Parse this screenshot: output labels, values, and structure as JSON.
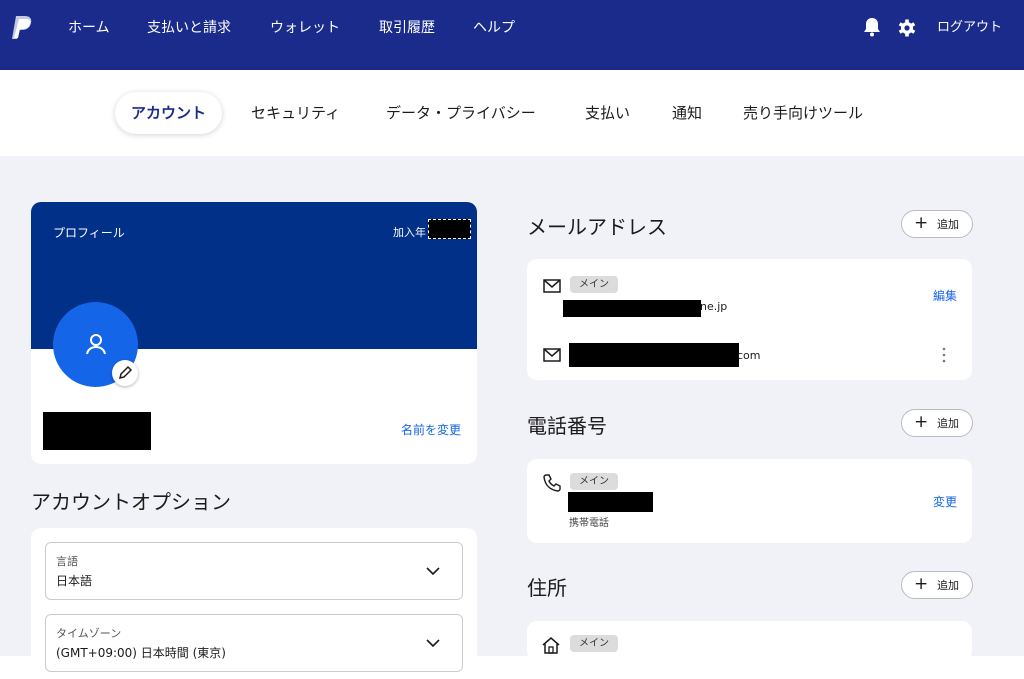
{
  "header": {
    "nav": [
      "ホーム",
      "支払いと請求",
      "ウォレット",
      "取引履歴",
      "ヘルプ"
    ],
    "logout": "ログアウト",
    "icons": [
      "bell-icon",
      "gear-icon"
    ],
    "bg_color": "#1a2b8c"
  },
  "tabs": [
    "アカウント",
    "セキュリティ",
    "データ・プライバシー",
    "支払い",
    "通知",
    "売り手向けツール"
  ],
  "profile": {
    "title": "プロフィール",
    "joined_label": "加入年",
    "change_name": "名前を変更",
    "banner_color": "#003087"
  },
  "account_options": {
    "title": "アカウントオプション",
    "language": {
      "label": "言語",
      "value": "日本語"
    },
    "timezone": {
      "label": "タイムゾーン",
      "value": "(GMT+09:00) 日本時間 (東京)"
    }
  },
  "email": {
    "title": "メールアドレス",
    "add": "追加",
    "items": [
      {
        "badge": "メイン",
        "suffix": "ne.jp",
        "action": "編集"
      },
      {
        "suffix": "com"
      }
    ]
  },
  "phone": {
    "title": "電話番号",
    "add": "追加",
    "badge": "メイン",
    "type": "携帯電話",
    "action": "変更"
  },
  "address": {
    "title": "住所",
    "add": "追加",
    "badge": "メイン"
  },
  "accent_color": "#1565e8"
}
